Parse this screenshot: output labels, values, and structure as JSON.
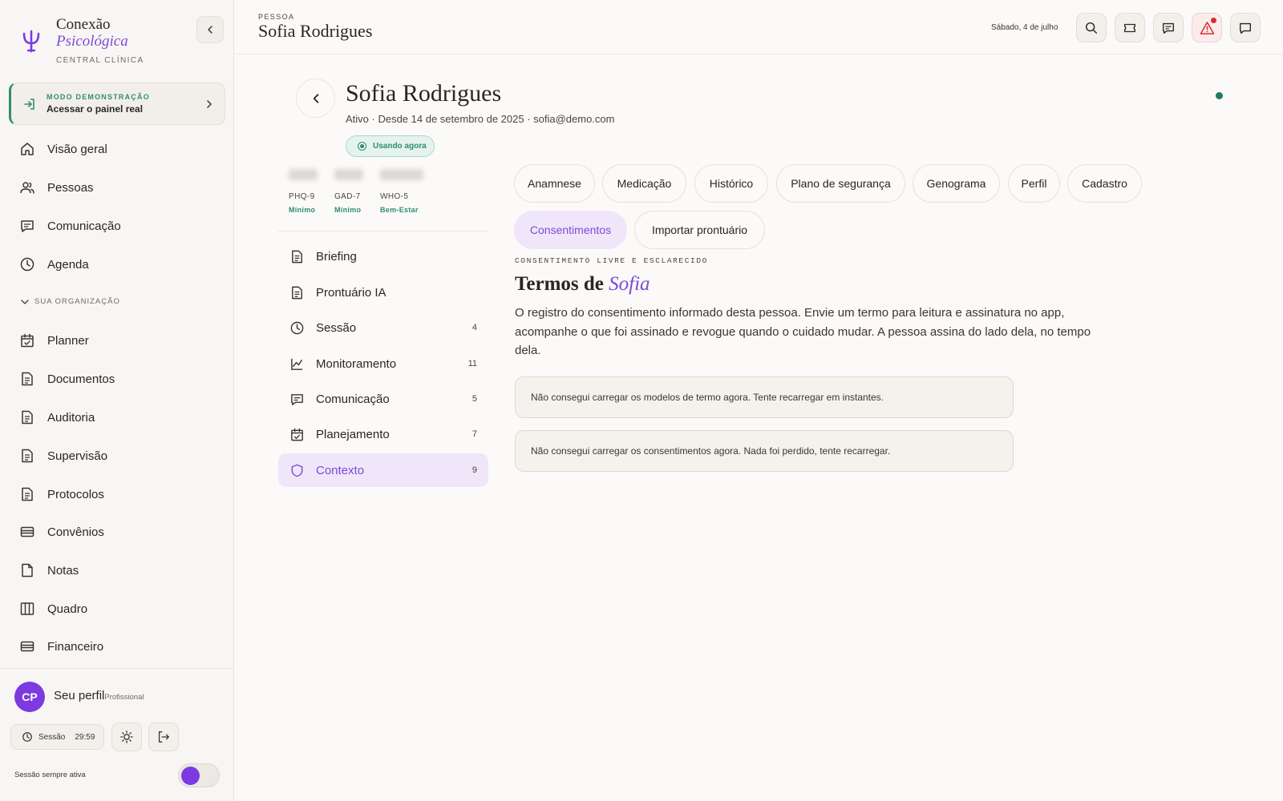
{
  "brand": {
    "name_line1": "Conexão",
    "name_line2": "Psicológica",
    "subtitle": "CENTRAL CLÍNICA"
  },
  "demo": {
    "tag": "MODO DEMONSTRAÇÃO",
    "label": "Acessar o painel real"
  },
  "nav": {
    "main": [
      {
        "label": "Visão geral",
        "icon": "home-icon"
      },
      {
        "label": "Pessoas",
        "icon": "people-icon"
      },
      {
        "label": "Comunicação",
        "icon": "chat-icon"
      },
      {
        "label": "Agenda",
        "icon": "clock-icon"
      }
    ],
    "org_header": "SUA ORGANIZAÇÃO",
    "org": [
      {
        "label": "Planner",
        "icon": "calendar-check-icon"
      },
      {
        "label": "Documentos",
        "icon": "document-icon"
      },
      {
        "label": "Auditoria",
        "icon": "document-icon"
      },
      {
        "label": "Supervisão",
        "icon": "document-icon"
      },
      {
        "label": "Protocolos",
        "icon": "document-icon"
      },
      {
        "label": "Convênios",
        "icon": "card-icon"
      },
      {
        "label": "Notas",
        "icon": "note-icon"
      },
      {
        "label": "Quadro",
        "icon": "columns-icon"
      },
      {
        "label": "Financeiro",
        "icon": "card-icon"
      }
    ]
  },
  "profile": {
    "initials": "CP",
    "name": "Seu perfil",
    "role": "Profissional"
  },
  "session": {
    "label": "Sessão",
    "time": "29:59",
    "always_active_label": "Sessão sempre ativa",
    "always_active": true
  },
  "topbar": {
    "kicker": "PESSOA",
    "title": "Sofia Rodrigues",
    "date": "Sábado, 4 de julho"
  },
  "person": {
    "name": "Sofia Rodrigues",
    "meta": "Ativo · Desde 14 de setembro de 2025 · sofia@demo.com",
    "badge": "Usando agora"
  },
  "scores": [
    {
      "name": "PHQ-9",
      "level": "Mínimo"
    },
    {
      "name": "GAD-7",
      "level": "Mínimo"
    },
    {
      "name": "WHO-5",
      "level": "Bem-Estar"
    }
  ],
  "subnav": [
    {
      "label": "Briefing",
      "count": "",
      "icon": "document-icon"
    },
    {
      "label": "Prontuário IA",
      "count": "",
      "icon": "document-icon"
    },
    {
      "label": "Sessão",
      "count": "4",
      "icon": "clock-icon"
    },
    {
      "label": "Monitoramento",
      "count": "11",
      "icon": "chart-line-icon"
    },
    {
      "label": "Comunicação",
      "count": "5",
      "icon": "chat-icon"
    },
    {
      "label": "Planejamento",
      "count": "7",
      "icon": "calendar-check-icon"
    },
    {
      "label": "Contexto",
      "count": "9",
      "icon": "shield-icon",
      "active": true
    }
  ],
  "tabs": [
    {
      "label": "Anamnese"
    },
    {
      "label": "Medicação"
    },
    {
      "label": "Histórico"
    },
    {
      "label": "Plano de segurança"
    },
    {
      "label": "Genograma"
    },
    {
      "label": "Perfil"
    },
    {
      "label": "Cadastro"
    },
    {
      "label": "Consentimentos",
      "active": true
    },
    {
      "label": "Importar prontuário"
    }
  ],
  "section": {
    "kicker": "CONSENTIMENTO LIVRE E ESCLARECIDO",
    "title_prefix": "Termos de ",
    "title_highlight": "Sofia",
    "description": "O registro do consentimento informado desta pessoa. Envie um termo para leitura e assinatura no app, acompanhe o que foi assinado e revogue quando o cuidado mudar. A pessoa assina do lado dela, no tempo dela.",
    "errors": [
      "Não consegui carregar os modelos de termo agora. Tente recarregar em instantes.",
      "Não consegui carregar os consentimentos agora. Nada foi perdido, tente recarregar."
    ]
  },
  "colors": {
    "accent": "#7c3ae0",
    "accent_text": "#7c4ad6",
    "teal": "#2f8c74",
    "alert": "#d92c2c"
  }
}
